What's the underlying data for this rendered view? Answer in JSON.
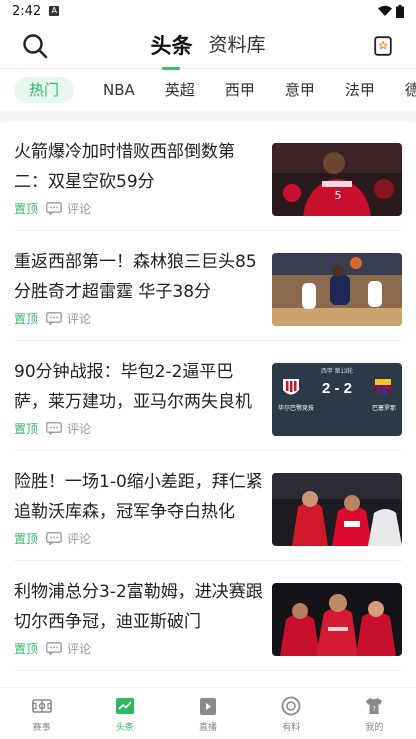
{
  "status": {
    "time": "2:42"
  },
  "header": {
    "tabs": [
      {
        "label": "头条",
        "active": true
      },
      {
        "label": "资料库",
        "active": false
      }
    ]
  },
  "categories": [
    {
      "label": "热门",
      "active": true
    },
    {
      "label": "NBA",
      "active": false
    },
    {
      "label": "英超",
      "active": false
    },
    {
      "label": "西甲",
      "active": false
    },
    {
      "label": "意甲",
      "active": false
    },
    {
      "label": "法甲",
      "active": false
    },
    {
      "label": "德甲",
      "active": false
    }
  ],
  "articles": [
    {
      "title": "火箭爆冷加时惜败西部倒数第二：双星空砍59分",
      "tag": "置顶",
      "comment_label": "评论",
      "thumb": "basketball-rockets"
    },
    {
      "title": "重返西部第一！森林狼三巨头85分胜奇才超雷霆 华子38分",
      "tag": "置顶",
      "comment_label": "评论",
      "thumb": "basketball-dunk"
    },
    {
      "title": "90分钟战报：毕包2-2逼平巴萨，莱万建功，亚马尔两失良机",
      "tag": "置顶",
      "comment_label": "评论",
      "thumb": "score-card",
      "score_card": {
        "top": "西甲 第13轮",
        "score": "2 - 2",
        "home": "毕尔巴鄂竞技",
        "away": "巴塞罗那"
      }
    },
    {
      "title": "险胜！一场1-0缩小差距，拜仁紧追勒沃库森，冠军争夺白热化",
      "tag": "置顶",
      "comment_label": "评论",
      "thumb": "football-red"
    },
    {
      "title": "利物浦总分3-2富勒姆，进决赛跟切尔西争冠，迪亚斯破门",
      "tag": "置顶",
      "comment_label": "评论",
      "thumb": "football-liverpool"
    }
  ],
  "bottom_nav": [
    {
      "label": "赛事",
      "icon": "stadium-icon",
      "active": false
    },
    {
      "label": "头条",
      "icon": "news-chart-icon",
      "active": true
    },
    {
      "label": "直播",
      "icon": "live-play-icon",
      "active": false
    },
    {
      "label": "有料",
      "icon": "discover-icon",
      "active": false
    },
    {
      "label": "我的",
      "icon": "jersey-icon",
      "active": false
    }
  ],
  "colors": {
    "accent": "#2fb863",
    "accent_bg": "#e9f8ee"
  }
}
